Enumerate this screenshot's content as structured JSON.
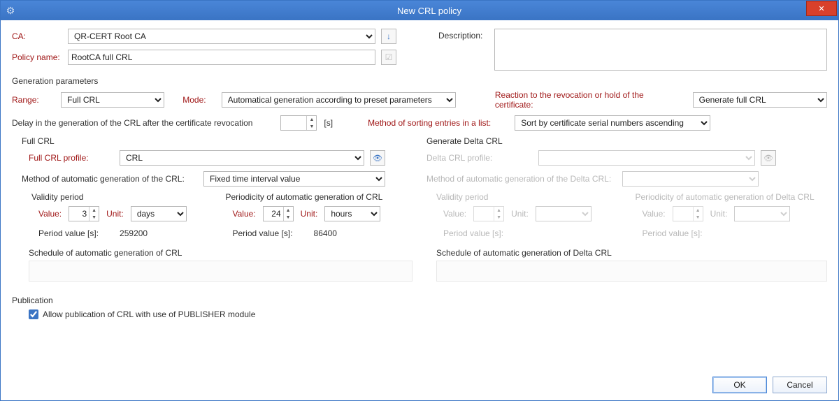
{
  "window": {
    "title": "New CRL policy"
  },
  "labels": {
    "ca": "CA:",
    "policy_name": "Policy name:",
    "description": "Description:",
    "gen_params": "Generation parameters",
    "range": "Range:",
    "mode": "Mode:",
    "reaction": "Reaction to the revocation or hold of the certificate:",
    "delay": "Delay in the generation of the CRL after the certificate revocation",
    "delay_unit": "[s]",
    "sort_method": "Method of sorting entries in a list:",
    "full_crl": "Full CRL",
    "full_crl_profile": "Full CRL profile:",
    "auto_gen_method": "Method of automatic generation of the CRL:",
    "validity_period": "Validity period",
    "periodicity_full": "Periodicity of automatic generation of CRL",
    "value": "Value:",
    "unit": "Unit:",
    "period_value_s": "Period value [s]:",
    "schedule_full": "Schedule of automatic generation of CRL",
    "gen_delta": "Generate Delta CRL",
    "delta_profile": "Delta CRL profile:",
    "auto_gen_delta": "Method of automatic generation of the Delta CRL:",
    "periodicity_delta": "Periodicity of automatic generation of Delta CRL",
    "schedule_delta": "Schedule of automatic generation of Delta CRL",
    "publication": "Publication",
    "allow_pub": "Allow publication of CRL with use of PUBLISHER module",
    "ok": "OK",
    "cancel": "Cancel"
  },
  "values": {
    "ca": "QR-CERT Root CA",
    "policy_name": "RootCA full CRL",
    "description": "",
    "range": "Full CRL",
    "mode": "Automatical generation according to preset parameters",
    "reaction": "Generate full CRL",
    "delay": "",
    "sort": "Sort by certificate serial numbers ascending",
    "full_profile": "CRL",
    "auto_gen_method": "Fixed time interval value",
    "full_validity_value": "3",
    "full_validity_unit": "days",
    "full_validity_seconds": "259200",
    "full_period_value": "24",
    "full_period_unit": "hours",
    "full_period_seconds": "86400",
    "delta_profile": "",
    "delta_auto_gen": "",
    "delta_validity_value": "",
    "delta_validity_unit": "",
    "delta_validity_seconds": "",
    "delta_period_value": "",
    "delta_period_unit": "",
    "delta_period_seconds": "",
    "allow_pub_checked": true
  },
  "icons": {
    "down_arrow": "↓",
    "eye": "👁",
    "check": "✓",
    "close": "✕",
    "gear": "⚙"
  }
}
